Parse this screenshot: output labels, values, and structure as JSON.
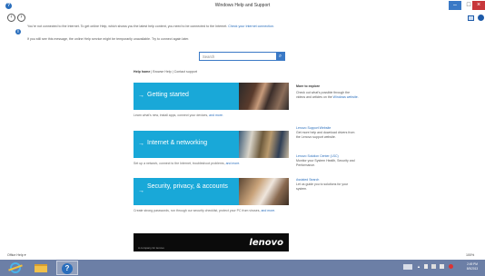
{
  "window": {
    "title": "Windows Help and Support",
    "min_label": "–",
    "max_label": "□",
    "close_label": "×"
  },
  "nav": {
    "back_label": "‹",
    "forward_label": "›"
  },
  "notice": {
    "line1_text": "You're not connected to the Internet. To get online Help, which shows you the latest help content, you need to be connected to the Internet. ",
    "line1_link": "Check your Internet connection.",
    "line2_text": "If you still see this message, the online Help service might be temporarily unavailable. Try to connect again later."
  },
  "search": {
    "placeholder": "Search",
    "button_glyph": "⌕"
  },
  "breadcrumb": {
    "home": "Help home",
    "rest": " | Browse Help | Contact support"
  },
  "tiles": [
    {
      "label": "Getting started",
      "desc": "Learn what's new, install apps, connect your devices, ",
      "desc_link": "and more."
    },
    {
      "label": "Internet & networking",
      "desc": "Set up a network, connect to the Internet, troubleshoot problems, ",
      "desc_link": "and more."
    },
    {
      "label": "Security, privacy, & accounts",
      "desc": "Create strong passwords, run through our security checklist, protect your PC from viruses, ",
      "desc_link": "and more."
    }
  ],
  "tile_arrow": "→",
  "banner": {
    "logo": "lenovo",
    "small_text": "A company for lenovo"
  },
  "sidebar": {
    "heading": "More to explore",
    "intro": "Check out what's possible through the videos and articles on the ",
    "intro_link": "Windows website.",
    "items": [
      {
        "title": "Lenovo Support Website",
        "desc": "Get more help and download drivers from the Lenovo support website."
      },
      {
        "title": "Lenovo Solution Center (LSC)",
        "desc": "Monitor your System Health, Security and Performance."
      },
      {
        "title": "Assisted Search",
        "desc": "Let us guide you to solutions for your system."
      }
    ]
  },
  "status": {
    "office_help": "Office Help ▾",
    "zoom": "100%"
  },
  "taskbar": {
    "help_glyph": "?",
    "tray_arrow": "▲",
    "time": "2:49 PM",
    "date": "8/5/2013"
  },
  "colors": {
    "accent": "#19a8d8",
    "link": "#2a6ebc",
    "taskbar": "#6c7fa6"
  }
}
